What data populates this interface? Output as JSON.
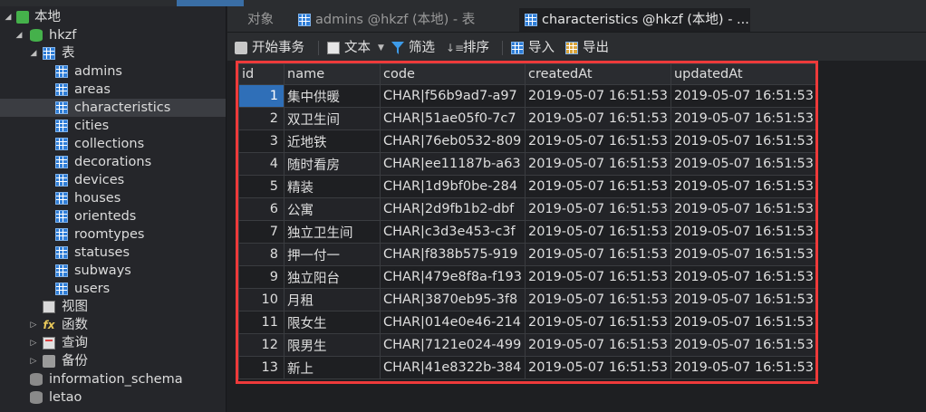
{
  "sidebar": {
    "connection": "本地",
    "database": "hkzf",
    "tables_group": "表",
    "tables": [
      "admins",
      "areas",
      "characteristics",
      "cities",
      "collections",
      "decorations",
      "devices",
      "houses",
      "orienteds",
      "roomtypes",
      "statuses",
      "subways",
      "users"
    ],
    "selected_table": "characteristics",
    "views": "视图",
    "functions": "函数",
    "queries": "查询",
    "backups": "备份",
    "other_databases": [
      "information_schema",
      "letao"
    ]
  },
  "tabs": [
    {
      "label": "对象",
      "active": false,
      "icon": null
    },
    {
      "label": "admins @hkzf (本地) - 表",
      "active": false,
      "icon": "table-icon"
    },
    {
      "label": "characteristics @hkzf (本地) - ...",
      "active": true,
      "icon": "table-icon"
    }
  ],
  "toolbar": {
    "begin_transaction": "开始事务",
    "text": "文本",
    "filter": "筛选",
    "sort": "排序",
    "import": "导入",
    "export": "导出"
  },
  "grid": {
    "columns": [
      "id",
      "name",
      "code",
      "createdAt",
      "updatedAt"
    ],
    "rows": [
      [
        "1",
        "集中供暖",
        "CHAR|f56b9ad7-a97",
        "2019-05-07 16:51:53",
        "2019-05-07 16:51:53"
      ],
      [
        "2",
        "双卫生间",
        "CHAR|51ae05f0-7c7",
        "2019-05-07 16:51:53",
        "2019-05-07 16:51:53"
      ],
      [
        "3",
        "近地铁",
        "CHAR|76eb0532-809",
        "2019-05-07 16:51:53",
        "2019-05-07 16:51:53"
      ],
      [
        "4",
        "随时看房",
        "CHAR|ee11187b-a63",
        "2019-05-07 16:51:53",
        "2019-05-07 16:51:53"
      ],
      [
        "5",
        "精装",
        "CHAR|1d9bf0be-284",
        "2019-05-07 16:51:53",
        "2019-05-07 16:51:53"
      ],
      [
        "6",
        "公寓",
        "CHAR|2d9fb1b2-dbf",
        "2019-05-07 16:51:53",
        "2019-05-07 16:51:53"
      ],
      [
        "7",
        "独立卫生间",
        "CHAR|c3d3e453-c3f",
        "2019-05-07 16:51:53",
        "2019-05-07 16:51:53"
      ],
      [
        "8",
        "押一付一",
        "CHAR|f838b575-919",
        "2019-05-07 16:51:53",
        "2019-05-07 16:51:53"
      ],
      [
        "9",
        "独立阳台",
        "CHAR|479e8f8a-f193",
        "2019-05-07 16:51:53",
        "2019-05-07 16:51:53"
      ],
      [
        "10",
        "月租",
        "CHAR|3870eb95-3f8",
        "2019-05-07 16:51:53",
        "2019-05-07 16:51:53"
      ],
      [
        "11",
        "限女生",
        "CHAR|014e0e46-214",
        "2019-05-07 16:51:53",
        "2019-05-07 16:51:53"
      ],
      [
        "12",
        "限男生",
        "CHAR|7121e024-499",
        "2019-05-07 16:51:53",
        "2019-05-07 16:51:53"
      ],
      [
        "13",
        "新上",
        "CHAR|41e8322b-384",
        "2019-05-07 16:51:53",
        "2019-05-07 16:51:53"
      ]
    ],
    "selected_row": 0
  },
  "colors": {
    "highlight_frame": "#ee3a3a",
    "selection": "#2f6fb8"
  }
}
